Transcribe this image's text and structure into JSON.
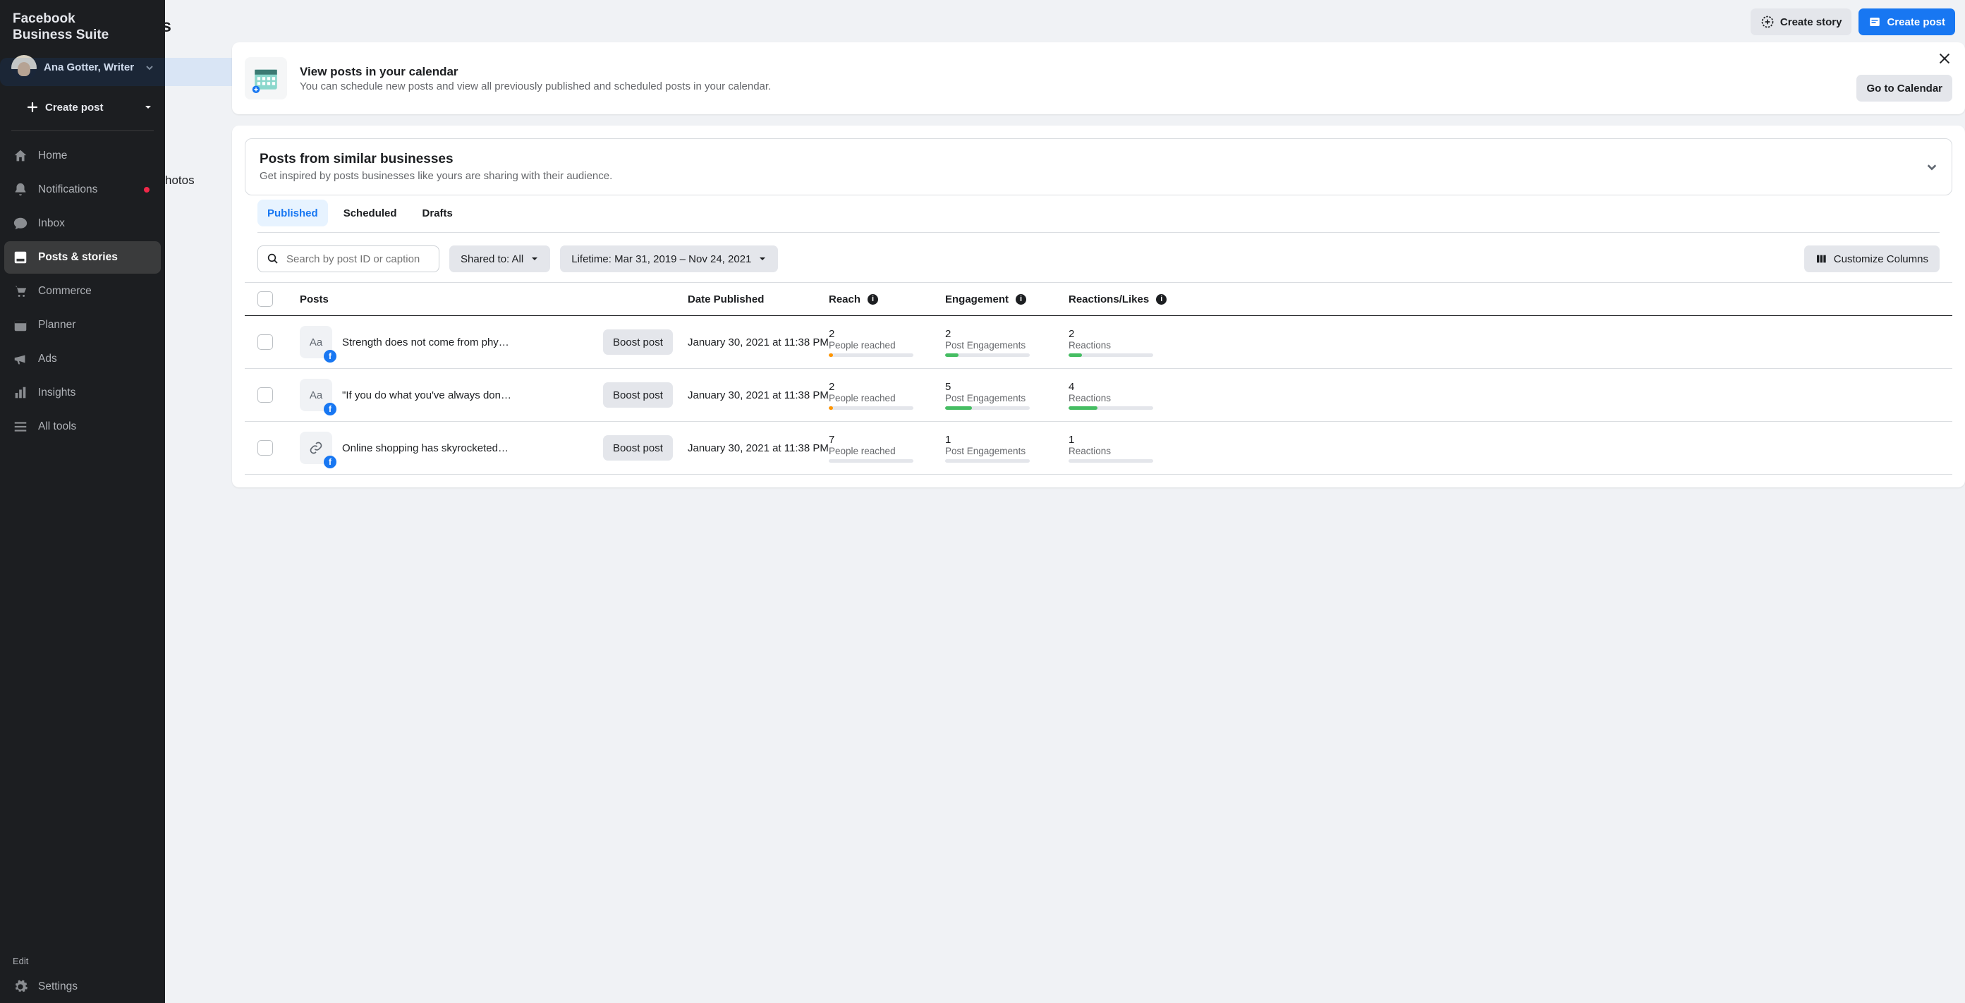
{
  "app_title_line1": "Facebook",
  "app_title_line2": "Business Suite",
  "profile_name": "Ana Gotter, Writer",
  "create_post_sidebar": "Create post",
  "nav": [
    {
      "id": "home",
      "label": "Home"
    },
    {
      "id": "notifications",
      "label": "Notifications",
      "dot": true
    },
    {
      "id": "inbox",
      "label": "Inbox"
    },
    {
      "id": "posts",
      "label": "Posts & stories",
      "active": true
    },
    {
      "id": "commerce",
      "label": "Commerce"
    },
    {
      "id": "planner",
      "label": "Planner"
    },
    {
      "id": "ads",
      "label": "Ads"
    },
    {
      "id": "insights",
      "label": "Insights"
    },
    {
      "id": "alltools",
      "label": "All tools"
    }
  ],
  "edit_label": "Edit",
  "settings_label": "Settings",
  "behind_photos": "hotos",
  "behind_s": "s",
  "topbar": {
    "create_story": "Create story",
    "create_post": "Create post"
  },
  "calendar": {
    "title": "View posts in your calendar",
    "subtitle": "You can schedule new posts and view all previously published and scheduled posts in your calendar.",
    "button": "Go to Calendar"
  },
  "similar": {
    "title": "Posts from similar businesses",
    "subtitle": "Get inspired by posts businesses like yours are sharing with their audience."
  },
  "tabs": {
    "published": "Published",
    "scheduled": "Scheduled",
    "drafts": "Drafts"
  },
  "filters": {
    "search_placeholder": "Search by post ID or caption",
    "shared_to": "Shared to: All",
    "lifetime": "Lifetime: Mar 31, 2019 – Nov 24, 2021",
    "customize": "Customize Columns"
  },
  "columns": {
    "posts": "Posts",
    "date": "Date Published",
    "reach": "Reach",
    "engagement": "Engagement",
    "reactions": "Reactions/Likes"
  },
  "labels": {
    "people_reached": "People reached",
    "post_engagements": "Post Engagements",
    "reactions": "Reactions",
    "boost": "Boost post"
  },
  "rows": [
    {
      "thumb_type": "text",
      "thumb_text": "Aa",
      "title": "Strength does not come from phy…",
      "date": "January 30, 2021 at 11:38 PM",
      "reach": "2",
      "reach_bar": 5,
      "reach_color": "orange",
      "eng": "2",
      "eng_bar": 16,
      "eng_color": "green",
      "react": "2",
      "react_bar": 16,
      "react_color": "green"
    },
    {
      "thumb_type": "text",
      "thumb_text": "Aa",
      "title": "\"If you do what you've always don…",
      "date": "January 30, 2021 at 11:38 PM",
      "reach": "2",
      "reach_bar": 5,
      "reach_color": "orange",
      "eng": "5",
      "eng_bar": 32,
      "eng_color": "green",
      "react": "4",
      "react_bar": 34,
      "react_color": "green"
    },
    {
      "thumb_type": "link",
      "title": "Online shopping has skyrocketed …",
      "date": "January 30, 2021 at 11:38 PM",
      "reach": "7",
      "reach_bar": 0,
      "reach_color": "orange",
      "eng": "1",
      "eng_bar": 0,
      "eng_color": "green",
      "react": "1",
      "react_bar": 0,
      "react_color": "green"
    }
  ]
}
